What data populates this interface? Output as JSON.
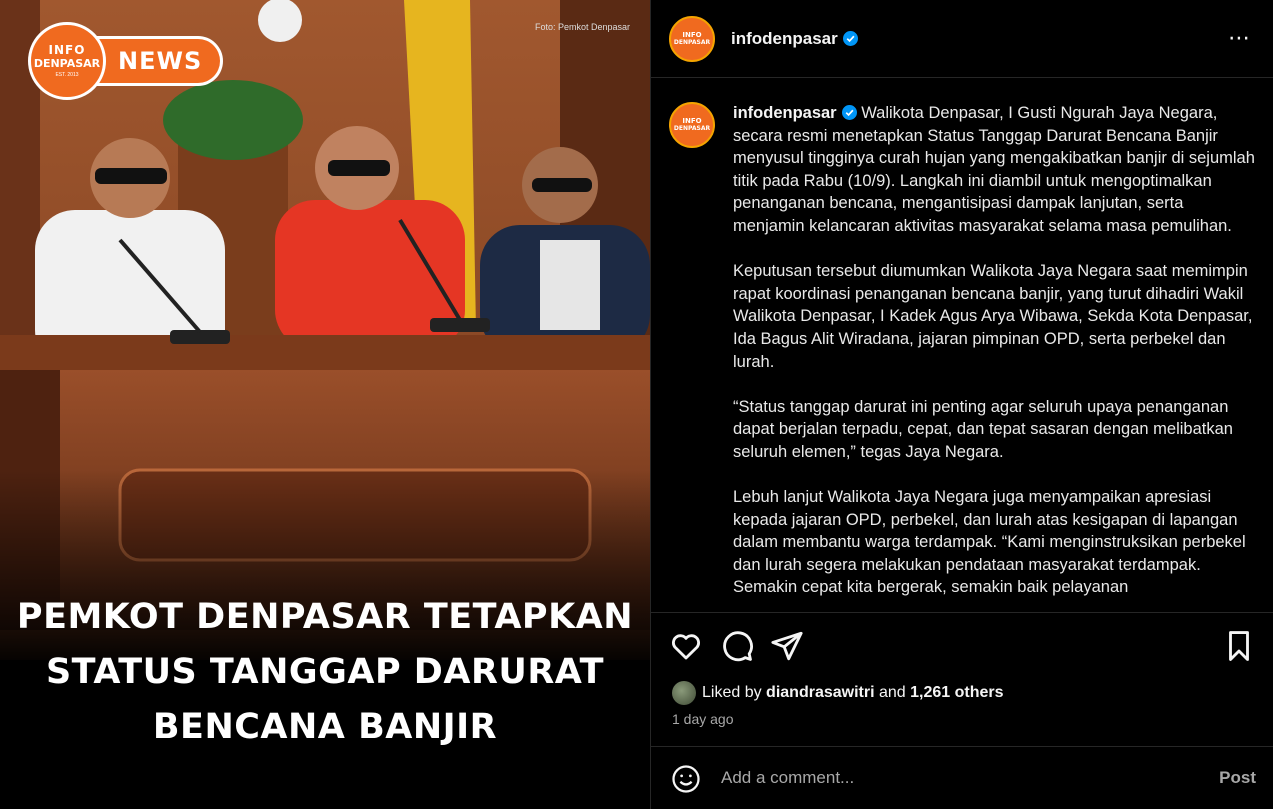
{
  "media": {
    "badge_line1": "INFO",
    "badge_line2": "DENPASAR",
    "badge_line3": "EST. 2013",
    "badge_label": "NEWS",
    "photo_credit": "Foto: Pemkot Denpasar",
    "headline_lines": [
      "PEMKOT DENPASAR TETAPKAN",
      "STATUS TANGGAP DARURAT",
      "BENCANA BANJIR"
    ]
  },
  "header": {
    "avatar_line1": "INFO",
    "avatar_line2": "DENPASAR",
    "username": "infodenpasar",
    "more_icon": "⋯"
  },
  "caption": {
    "username": "infodenpasar",
    "paragraphs": [
      "Walikota Denpasar, I Gusti Ngurah Jaya Negara, secara resmi menetapkan Status Tanggap Darurat Bencana Banjir menyusul tingginya curah hujan yang mengakibatkan banjir di sejumlah titik pada Rabu (10/9). Langkah ini diambil untuk mengoptimalkan penanganan bencana, mengantisipasi dampak lanjutan, serta menjamin kelancaran aktivitas masyarakat selama masa pemulihan.",
      "Keputusan tersebut diumumkan Walikota Jaya Negara saat memimpin rapat koordinasi penanganan bencana banjir, yang turut dihadiri Wakil Walikota Denpasar, I Kadek Agus Arya Wibawa, Sekda Kota Denpasar, Ida Bagus Alit Wiradana, jajaran pimpinan OPD, serta perbekel dan lurah.",
      "“Status tanggap darurat ini penting agar seluruh upaya penanganan dapat berjalan terpadu, cepat, dan tepat sasaran dengan melibatkan seluruh elemen,” tegas Jaya Negara.",
      "Lebuh lanjut Walikota Jaya Negara juga menyampaikan apresiasi kepada jajaran OPD, perbekel, dan lurah atas kesigapan di lapangan dalam membantu warga terdampak. “Kami menginstruksikan perbekel dan lurah segera melakukan pendataan masyarakat terdampak. Semakin cepat kita bergerak, semakin baik pelayanan"
    ]
  },
  "likes": {
    "prefix": "Liked by",
    "liker": "diandrasawitri",
    "joiner": "and",
    "others": "1,261 others"
  },
  "time_ago": "1 day ago",
  "comment": {
    "placeholder": "Add a comment...",
    "post_label": "Post"
  },
  "colors": {
    "brand_orange": "#f06a1f",
    "verified_blue": "#0095f6",
    "panel_bg": "#000000",
    "muted_text": "#a8a8a8"
  }
}
